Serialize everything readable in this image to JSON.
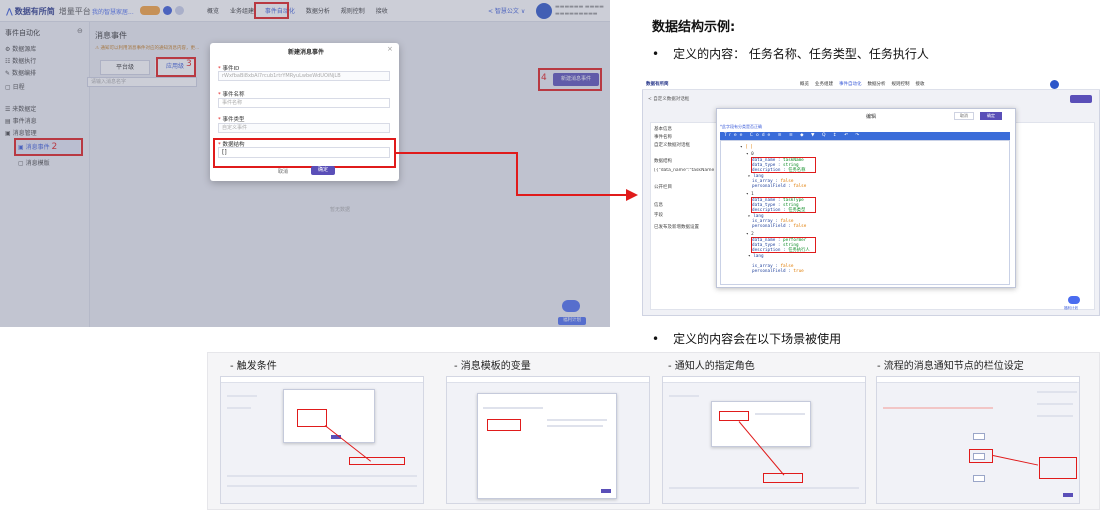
{
  "main_screenshot": {
    "logo": "数据有所简",
    "logo_sub": "增量平台",
    "breadcrumb": "我的智慧家居...",
    "nav": [
      "概览",
      "业务组建",
      "事件自动化",
      "数据分析",
      "规则控制",
      "接收"
    ],
    "nav_active": "事件自动化",
    "user_area": "< 智慧公文 ∨",
    "sidebar_title": "事件自动化",
    "sidebar_items": [
      "数据源库",
      "数据执行",
      "数据编排",
      "日程",
      "来数据定",
      "事件消息",
      "消息管理"
    ],
    "sidebar_active": "消息事件",
    "sidebar_last": "消息模版",
    "step2": "2",
    "page_title": "消息事件",
    "warning": "通知可以利用消息事件对应的通知消息内容，更...",
    "segment_platform": "平台级",
    "segment_app": "应用级",
    "step3": "3",
    "search_placeholder": "请输入消息名字",
    "step4": "4",
    "new_button": "新建消息事件",
    "empty_text": "暂无数据",
    "robot_label": "福利计划",
    "modal": {
      "title": "新建消息事件",
      "close": "×",
      "event_id_label": "事件ID",
      "event_id_value": "rWxfbaBi8xbAl7rcub1rtrYMRyuLwbeWdUOiNjLB",
      "event_name_label": "事件名称",
      "event_name_placeholder": "事件名称",
      "event_type_label": "事件类型",
      "event_type_value": "自定义事件",
      "struct_label": "数据结构",
      "struct_value": "[]",
      "cancel": "取消",
      "ok": "确定"
    }
  },
  "right": {
    "title": "数据结构示例:",
    "bullet1": "定义的内容： 任务名称、任务类型、任务执行人",
    "bullet2": "定义的内容会在以下场景被使用",
    "bullet_mark": "•",
    "screenshot": {
      "logo": "数据有所简",
      "nav": [
        "概览",
        "业务组建",
        "事件自动化",
        "数据分析",
        "规则控制",
        "接收"
      ],
      "sub": "< 自定义数据对话框",
      "labels": [
        "基本信息",
        "事件名称",
        "自定义数据对话框",
        "数据结构",
        "[{\"data_name\":\"taskName\",\"data_type...",
        "公开栏目",
        "信息",
        "字段",
        "已发布及新增数据设置"
      ],
      "dialog_title": "编辑",
      "dialog_cancel": "取消",
      "dialog_ok": "确定",
      "hint": "*此字段有分类是否正确",
      "toolbar": "Tree Code ≡ ≡ ◆ ▼ Q ↕ ↶ ↷",
      "code_blocks": [
        {
          "data_name": "taskName",
          "data_type": "string",
          "description": "任务名称"
        },
        {
          "data_name": "taskType",
          "data_type": "string",
          "description": "任务类型"
        },
        {
          "data_name": "performer",
          "data_type": "string",
          "description": "任务执行人"
        }
      ],
      "lang_label": "lang",
      "is_array_label": "is_array : ",
      "false_value": "false",
      "personal_label": "personalField : ",
      "true_value": "true",
      "robot_label": "福利计划"
    }
  },
  "scenarios": [
    {
      "caption": "- 触发条件"
    },
    {
      "caption": "- 消息模板的变量"
    },
    {
      "caption": "- 通知人的指定角色"
    },
    {
      "caption": "- 流程的消息通知节点的栏位设定"
    }
  ],
  "colors": {
    "accent": "#3a5bd9",
    "button": "#5a4fb8",
    "highlight": "#e01b1b"
  }
}
